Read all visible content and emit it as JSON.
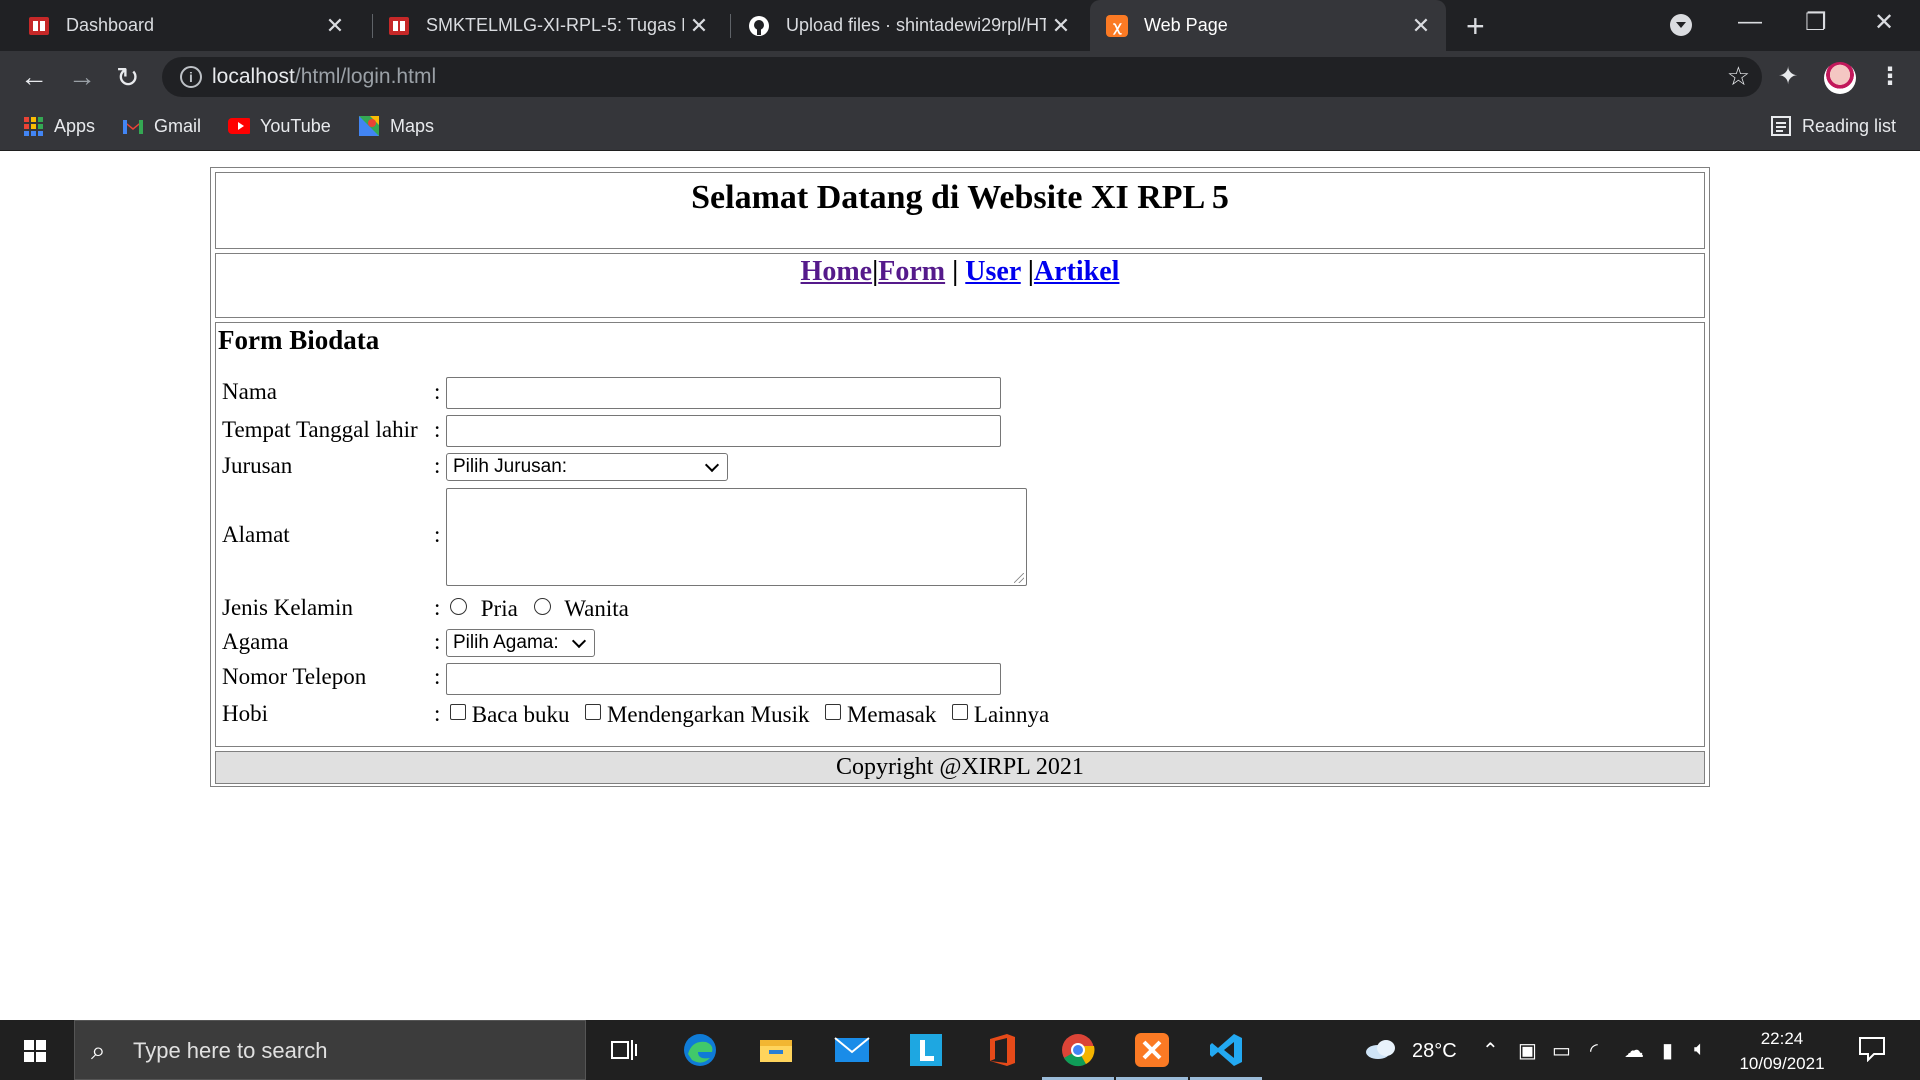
{
  "browser": {
    "tabs": [
      {
        "title": "Dashboard",
        "icon": "tab-favicon-red"
      },
      {
        "title": "SMKTELMLG-XI-RPL-5: Tugas Lay",
        "icon": "tab-favicon-red"
      },
      {
        "title": "Upload files · shintadewi29rpl/HT",
        "icon": "github-icon"
      },
      {
        "title": "Web Page",
        "icon": "xampp-icon"
      }
    ],
    "url_host": "localhost",
    "url_path": "/html/login.html",
    "bookmarks": [
      "Apps",
      "Gmail",
      "YouTube",
      "Maps"
    ],
    "reading_list": "Reading list"
  },
  "page": {
    "header_title": "Selamat Datang di Website XI RPL 5",
    "nav": {
      "home": "Home",
      "sep1": "|",
      "form": "Form",
      "sep2": " | ",
      "user": "User",
      "sep3": " |",
      "artikel": "Artikel"
    },
    "form_title": "Form Biodata",
    "colon": ":",
    "fields": {
      "nama": "Nama",
      "ttl": "Tempat Tanggal lahir",
      "jurusan": "Jurusan",
      "jurusan_selected": "Pilih Jurusan:",
      "alamat": "Alamat",
      "jenis_kelamin": "Jenis Kelamin",
      "pria": "Pria",
      "wanita": "Wanita",
      "agama": "Agama",
      "agama_selected": "Pilih Agama:",
      "telepon": "Nomor Telepon",
      "hobi": "Hobi",
      "hobi_options": [
        "Baca buku",
        "Mendengarkan Musik",
        "Memasak",
        "Lainnya"
      ]
    },
    "footer": "Copyright @XIRPL 2021"
  },
  "taskbar": {
    "search_placeholder": "Type here to search",
    "weather": "28°C",
    "time": "22:24",
    "date": "10/09/2021"
  }
}
